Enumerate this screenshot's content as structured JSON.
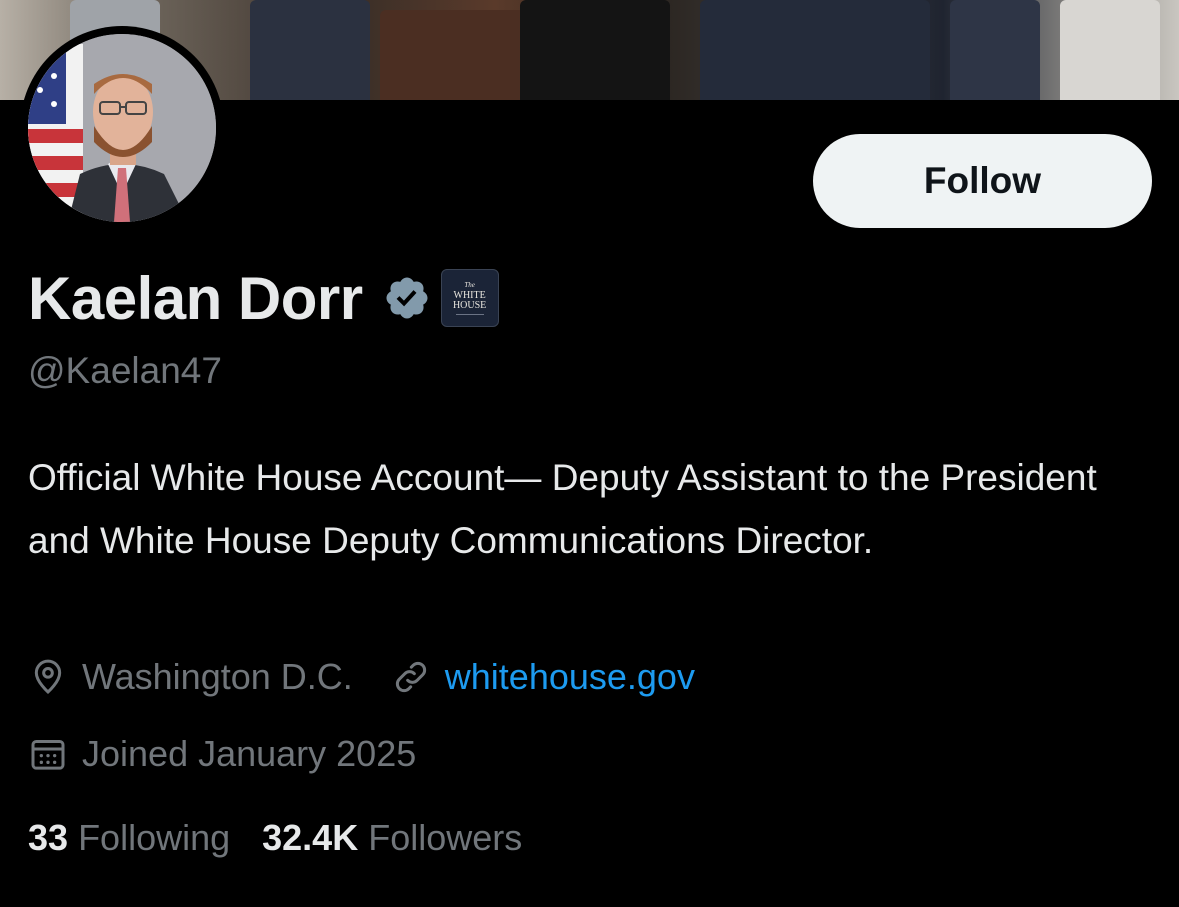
{
  "profile": {
    "name": "Kaelan Dorr",
    "handle": "@Kaelan47",
    "bio": "Official White House Account— Deputy Assistant to the President and White House Deputy Communications Director.",
    "location": "Washington D.C.",
    "website": "whitehouse.gov",
    "joined": "Joined January 2025",
    "following_count": "33",
    "following_label": "Following",
    "followers_count": "32.4K",
    "followers_label": "Followers",
    "affiliation_badge": {
      "line1": "The",
      "line2": "WHITE",
      "line3": "HOUSE"
    }
  },
  "actions": {
    "follow_label": "Follow"
  },
  "icons": {
    "verified": "verified-badge-icon",
    "location": "location-pin-icon",
    "link": "link-icon",
    "calendar": "calendar-icon"
  },
  "colors": {
    "background": "#000000",
    "text_primary": "#e7e9ea",
    "text_secondary": "#71767b",
    "link": "#1d9bf0",
    "verified_badge": "#829aab",
    "follow_button_bg": "#eff3f4",
    "follow_button_text": "#0f1419"
  }
}
